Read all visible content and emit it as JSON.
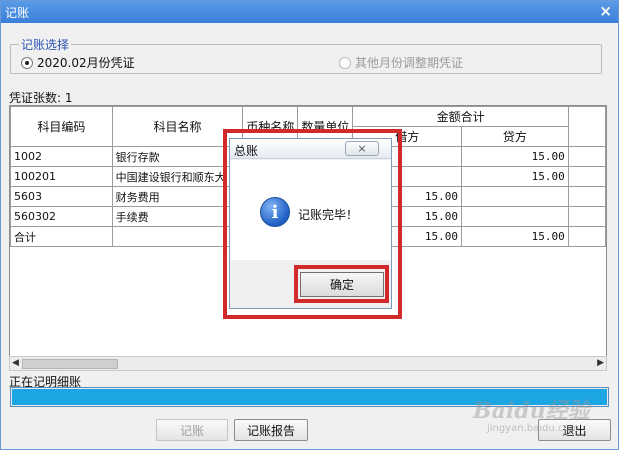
{
  "window": {
    "title": "记账",
    "close_glyph": "×"
  },
  "period_group": {
    "legend": "记账选择",
    "option_current": "2020.02月份凭证",
    "option_other": "其他月份调整期凭证"
  },
  "voucher_count": "凭证张数: 1",
  "table": {
    "headers": {
      "code": "科目编码",
      "name": "科目名称",
      "currency": "币种名称",
      "unit": "数量单位",
      "amount_total": "金额合计",
      "debit": "借方",
      "credit": "贷方"
    },
    "rows": [
      {
        "code": "1002",
        "name": "银行存款",
        "debit": "",
        "credit": "15.00"
      },
      {
        "code": "100201",
        "name": "中国建设银行和顺东大",
        "debit": "",
        "credit": "15.00"
      },
      {
        "code": "5603",
        "name": "财务费用",
        "debit": "15.00",
        "credit": ""
      },
      {
        "code": "560302",
        "name": "手续费",
        "debit": "15.00",
        "credit": ""
      },
      {
        "code": "合计",
        "name": "",
        "debit": "15.00",
        "credit": "15.00"
      }
    ]
  },
  "progress": {
    "label": "正在记明细账",
    "value_pct": 100,
    "color": "#1ba6e3"
  },
  "buttons": {
    "post": "记账",
    "report": "记账报告",
    "exit": "退出"
  },
  "dialog": {
    "title": "总账",
    "close_glyph": "×",
    "icon": "info-icon",
    "message": "记账完毕！",
    "ok": "确定"
  },
  "watermark": {
    "line1": "Baidu经验",
    "line2": "jingyan.baidu.com"
  },
  "colors": {
    "highlight": "#d22a2a",
    "title_bar": "#3a7fd8"
  }
}
